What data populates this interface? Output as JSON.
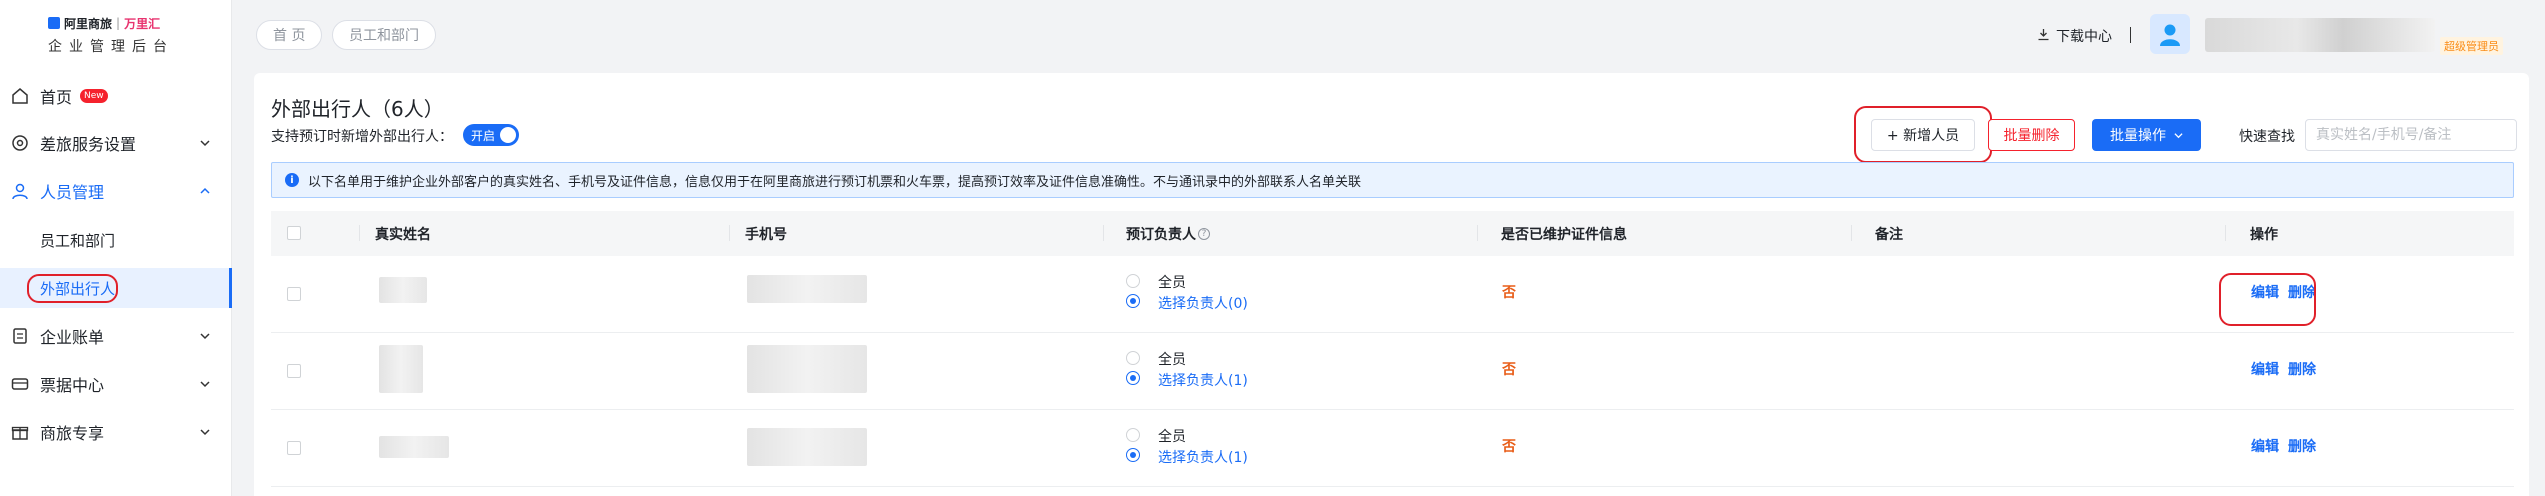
{
  "logo": {
    "brand": "阿里商旅",
    "sep": "|",
    "brand2": "万里汇",
    "subtitle": "企业管理后台"
  },
  "sidebar": {
    "items": [
      {
        "label": "首页",
        "badge": "New"
      },
      {
        "label": "差旅服务设置"
      },
      {
        "label": "人员管理"
      },
      {
        "label": "员工和部门"
      },
      {
        "label": "外部出行人"
      },
      {
        "label": "企业账单"
      },
      {
        "label": "票据中心"
      },
      {
        "label": "商旅专享"
      }
    ]
  },
  "header": {
    "breadcrumbs": [
      "首 页",
      "员工和部门"
    ],
    "download": "下载中心",
    "role": "超级管理员"
  },
  "page": {
    "title": "外部出行人（6人）",
    "subtitle": "支持预订时新增外部出行人：",
    "toggle": "开启",
    "add_button": "+ 新增人员",
    "batch_delete": "批量删除",
    "batch_ops": "批量操作",
    "quick_search": "快速查找",
    "search_placeholder": "真实姓名/手机号/备注",
    "notice": "以下名单用于维护企业外部客户的真实姓名、手机号及证件信息，信息仅用于在阿里商旅进行预订机票和火车票，提高预订效率及证件信息准确性。不与通讯录中的外部联系人名单关联"
  },
  "table": {
    "headers": [
      "真实姓名",
      "手机号",
      "预订负责人",
      "是否已维护证件信息",
      "备注",
      "操作"
    ],
    "help_glyph": "?",
    "rows": [
      {
        "opt1": "全员",
        "opt2": "选择负责人(0)",
        "maintained": "否",
        "edit": "编辑",
        "delete": "删除"
      },
      {
        "opt1": "全员",
        "opt2": "选择负责人(1)",
        "maintained": "否",
        "edit": "编辑",
        "delete": "删除"
      },
      {
        "opt1": "全员",
        "opt2": "选择负责人(1)",
        "maintained": "否",
        "edit": "编辑",
        "delete": "删除"
      }
    ]
  },
  "colors": {
    "accent": "#1a6cf6",
    "danger": "#f5222d",
    "highlight_ring": "#e0202a",
    "warn_text": "#e85d18"
  }
}
